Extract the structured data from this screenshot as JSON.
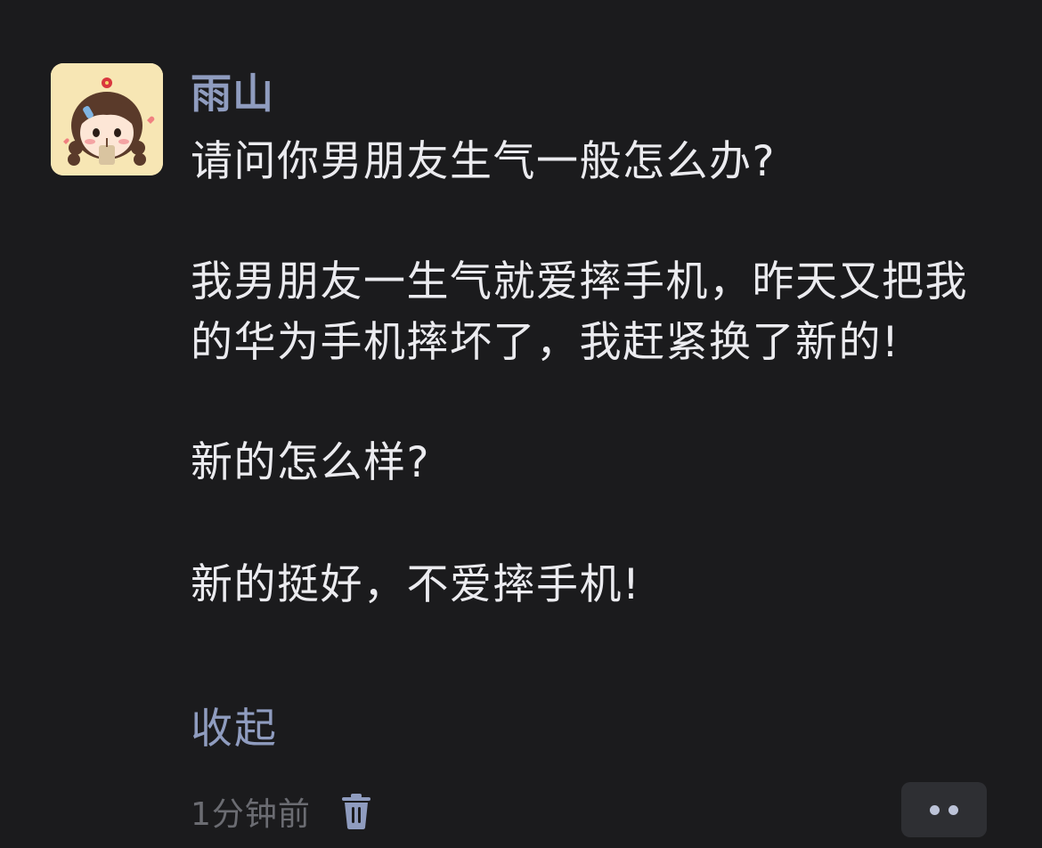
{
  "comment": {
    "username": "雨山",
    "paragraphs": [
      "请问你男朋友生气一般怎么办?",
      "我男朋友一生气就爱摔手机，昨天又把我的华为手机摔坏了，我赶紧换了新的!",
      "新的怎么样?",
      "新的挺好，不爱摔手机!"
    ],
    "collapse_label": "收起",
    "timestamp": "1分钟前",
    "delete_icon": "trash-icon",
    "more_icon": "more-dots-icon"
  },
  "colors": {
    "background": "#1b1b1d",
    "username": "#8f9cbf",
    "body_text": "#ebebef",
    "link": "#8f9cbf",
    "meta_text": "#6b6c72",
    "more_button_bg": "#2e2f33"
  }
}
